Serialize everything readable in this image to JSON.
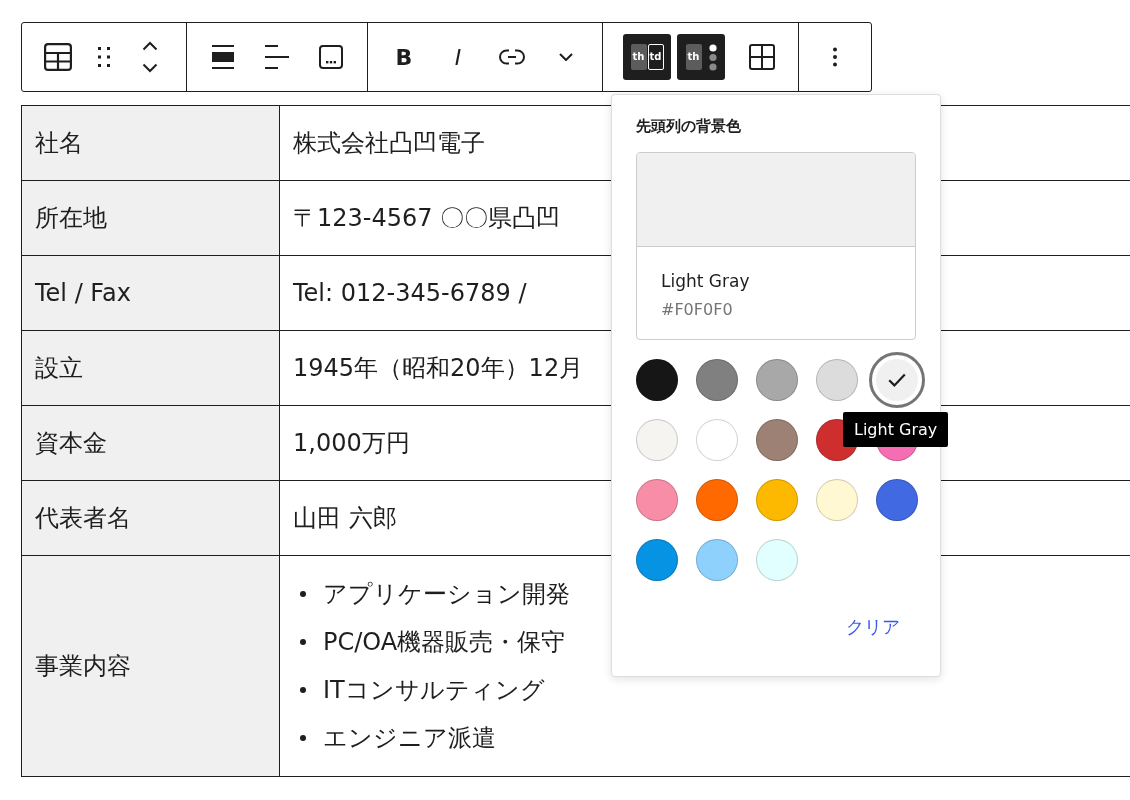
{
  "toolbar": {
    "groups": [
      {
        "buttons": [
          {
            "kind": "block-type",
            "pressed": false
          },
          {
            "kind": "drag",
            "pressed": false
          },
          {
            "kind": "move",
            "pressed": false
          }
        ]
      },
      {
        "buttons": [
          {
            "kind": "align",
            "pressed": false
          },
          {
            "kind": "text-align",
            "pressed": false
          },
          {
            "kind": "caption",
            "pressed": false
          }
        ]
      },
      {
        "buttons": [
          {
            "kind": "bold",
            "label": "B",
            "pressed": false
          },
          {
            "kind": "italic",
            "label": "I",
            "pressed": false
          },
          {
            "kind": "link",
            "pressed": false
          },
          {
            "kind": "more-formats",
            "pressed": false
          }
        ]
      },
      {
        "buttons": [
          {
            "kind": "header-section",
            "labels": [
              "th",
              "td"
            ],
            "pressed": true
          },
          {
            "kind": "first-column",
            "label": "th",
            "pressed": true
          },
          {
            "kind": "table-edit",
            "pressed": false
          }
        ]
      },
      {
        "buttons": [
          {
            "kind": "options",
            "pressed": false
          }
        ]
      }
    ]
  },
  "table": {
    "rows": [
      {
        "kind": "text",
        "header": "社名",
        "value": "株式会社凸凹電子"
      },
      {
        "kind": "text",
        "header": "所在地",
        "value": "〒123-4567 〇〇県凸凹"
      },
      {
        "kind": "text",
        "header": "Tel / Fax",
        "value": "Tel: 012-345-6789 /"
      },
      {
        "kind": "text",
        "header": "設立",
        "value": "1945年（昭和20年）12月"
      },
      {
        "kind": "text",
        "header": "資本金",
        "value": "1,000万円"
      },
      {
        "kind": "text",
        "header": "代表者名",
        "value": "山田 六郎"
      },
      {
        "kind": "list",
        "header": "事業内容",
        "items": [
          "アプリケーション開発",
          "PC/OA機器販売・保守",
          "ITコンサルティング",
          "エンジニア派遣"
        ]
      }
    ]
  },
  "color_popover": {
    "title": "先頭列の背景色",
    "preview": {
      "name": "Light Gray",
      "value": "#F0F0F0"
    },
    "swatches": [
      {
        "color": "#161616",
        "selected": false
      },
      {
        "color": "#808080",
        "selected": false
      },
      {
        "color": "#a8a8a8",
        "selected": false
      },
      {
        "color": "#dcdcdc",
        "selected": false
      },
      {
        "color": "#f0f0f0",
        "selected": true
      },
      {
        "color": "#f5f4f1",
        "selected": false
      },
      {
        "color": "#ffffff",
        "selected": false
      },
      {
        "color": "#9d8174",
        "selected": false
      },
      {
        "color": "#cf2e2e",
        "selected": false
      },
      {
        "color": "#f56db2",
        "selected": false
      },
      {
        "color": "#f78da7",
        "selected": false
      },
      {
        "color": "#ff6900",
        "selected": false
      },
      {
        "color": "#fcb900",
        "selected": false
      },
      {
        "color": "#fff8d2",
        "selected": false
      },
      {
        "color": "#4169e1",
        "selected": false
      },
      {
        "color": "#0693e3",
        "selected": false
      },
      {
        "color": "#8ed1fc",
        "selected": false
      },
      {
        "color": "#e0fffe",
        "selected": false
      }
    ],
    "tooltip": "Light Gray",
    "clear_label": "クリア"
  }
}
